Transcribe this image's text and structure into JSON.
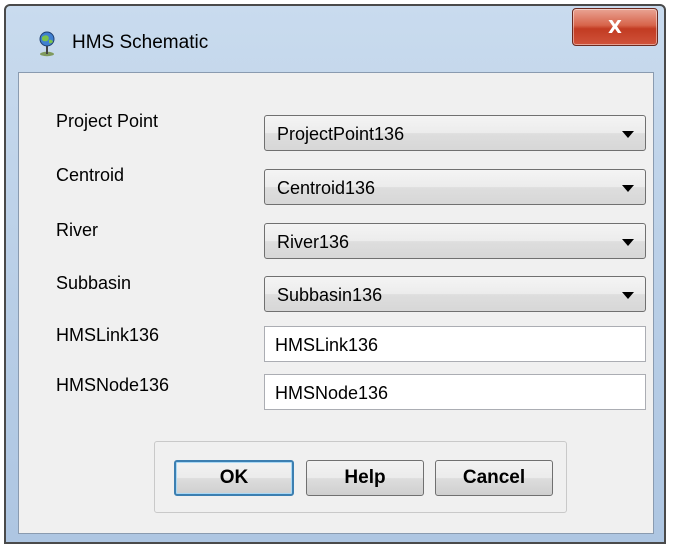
{
  "window": {
    "title": "HMS Schematic",
    "close_glyph": "X"
  },
  "form": {
    "rows": [
      {
        "label": "Project Point",
        "value": "ProjectPoint136",
        "type": "combo"
      },
      {
        "label": "Centroid",
        "value": "Centroid136",
        "type": "combo"
      },
      {
        "label": "River",
        "value": "River136",
        "type": "combo"
      },
      {
        "label": "Subbasin",
        "value": "Subbasin136",
        "type": "combo"
      },
      {
        "label": "HMSLink136",
        "value": "HMSLink136",
        "type": "text"
      },
      {
        "label": "HMSNode136",
        "value": "HMSNode136",
        "type": "text"
      }
    ]
  },
  "buttons": {
    "ok": "OK",
    "help": "Help",
    "cancel": "Cancel"
  },
  "icons": {
    "title_icon": "globe-pin-icon",
    "close_icon": "close-icon",
    "dropdown_icon": "chevron-down-icon"
  },
  "colors": {
    "close_button": "#c23b22",
    "default_button_border": "#3c7fb1",
    "client_background": "#f0f0f0"
  }
}
